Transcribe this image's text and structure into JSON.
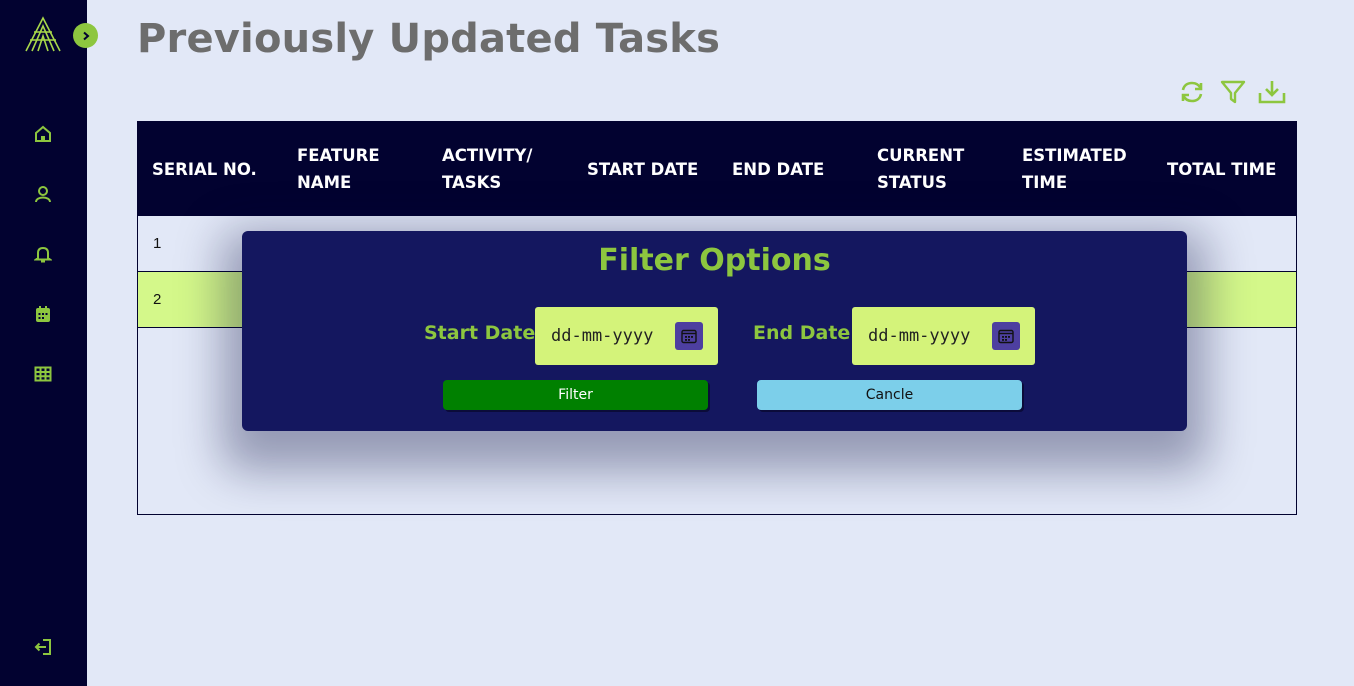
{
  "page": {
    "title": "Previously Updated Tasks"
  },
  "sidebar": {
    "logo": "app-logo",
    "expand_icon": "chevron-right-icon",
    "items": [
      {
        "name": "home",
        "icon": "home-icon"
      },
      {
        "name": "profile",
        "icon": "user-icon"
      },
      {
        "name": "notifications",
        "icon": "bell-icon"
      },
      {
        "name": "calendar",
        "icon": "calendar-icon"
      },
      {
        "name": "grid",
        "icon": "table-grid-icon"
      }
    ],
    "logout_icon": "logout-icon"
  },
  "toolbar": {
    "icons": [
      "refresh-icon",
      "filter-icon",
      "download-icon"
    ]
  },
  "colors": {
    "sidebar_bg": "#020230",
    "accent": "#8dc63f",
    "page_bg": "#e2e8f7",
    "modal_bg": "#14175f",
    "highlight_row": "#d4f88a",
    "filter_button": "#008000",
    "cancel_button": "#7ccfea"
  },
  "table": {
    "headers": [
      "SERIAL NO.",
      "FEATURE NAME",
      "ACTIVITY/ TASKS",
      "START DATE",
      "END DATE",
      "CURRENT STATUS",
      "ESTIMATED TIME",
      "TOTAL TIME"
    ],
    "rows": [
      {
        "serial": "1"
      },
      {
        "serial": "2"
      }
    ]
  },
  "filter_modal": {
    "title": "Filter Options",
    "start_label": "Start Date:",
    "start_placeholder": "dd-mm-yyyy",
    "end_label": "End Date:",
    "end_placeholder": "dd-mm-yyyy",
    "filter_button": "Filter",
    "cancel_button": "Cancle"
  }
}
